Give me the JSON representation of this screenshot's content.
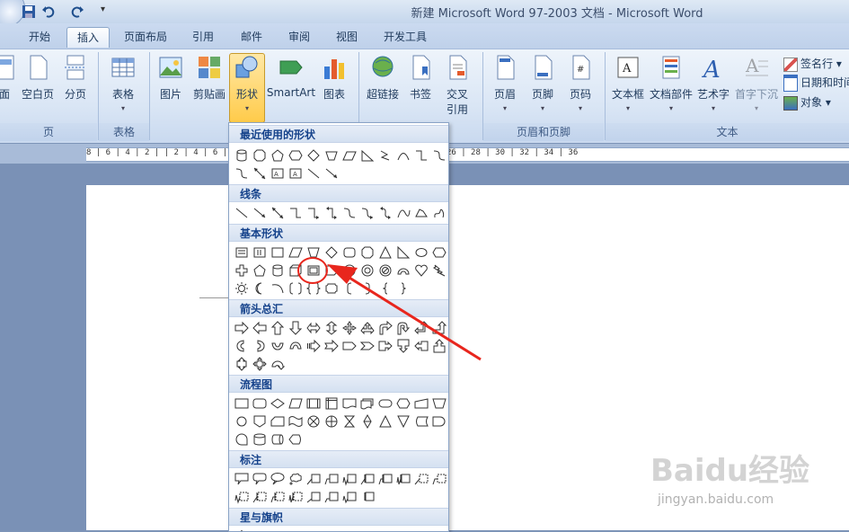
{
  "window": {
    "title": "新建 Microsoft Word 97-2003 文档 - Microsoft Word"
  },
  "tabs": [
    "开始",
    "插入",
    "页面布局",
    "引用",
    "邮件",
    "审阅",
    "视图",
    "开发工具"
  ],
  "active_tab": "插入",
  "ribbon": {
    "pages_group": {
      "buttons": [
        "面",
        "空白页",
        "分页"
      ],
      "label": "页"
    },
    "table_group": {
      "button": "表格",
      "label": "表格"
    },
    "illustrations_group": {
      "buttons": [
        "图片",
        "剪贴画",
        "形状",
        "SmartArt",
        "图表"
      ]
    },
    "links_group": {
      "buttons": [
        "超链接",
        "书签",
        "交叉",
        "引用"
      ]
    },
    "header_footer_group": {
      "buttons": [
        "页眉",
        "页脚",
        "页码"
      ],
      "label": "页眉和页脚"
    },
    "text_group": {
      "buttons": [
        "文本框",
        "文档部件",
        "艺术字",
        "首字下沉"
      ],
      "small": [
        "签名行",
        "日期和时间",
        "对象"
      ],
      "label": "文本"
    }
  },
  "ruler": {
    "ticks": "8 | 6 | 4 | 2 |   | 2 | 4 | 6 | 8 | 10 | 12 | 14 | 16 | 18 | 20 | 22 | 24 | 26 | 28 | 30 | 32 | 34 | 36"
  },
  "shapes_menu": {
    "sections": [
      "最近使用的形状",
      "线条",
      "基本形状",
      "箭头总汇",
      "流程图",
      "标注",
      "星与旗帜"
    ]
  },
  "watermark": {
    "main": "Baidu经验",
    "sub": "jingyan.baidu.com"
  },
  "colors": {
    "accent": "#e8261d",
    "ribbon": "#dae6f5",
    "menu_header": "#15428b"
  }
}
